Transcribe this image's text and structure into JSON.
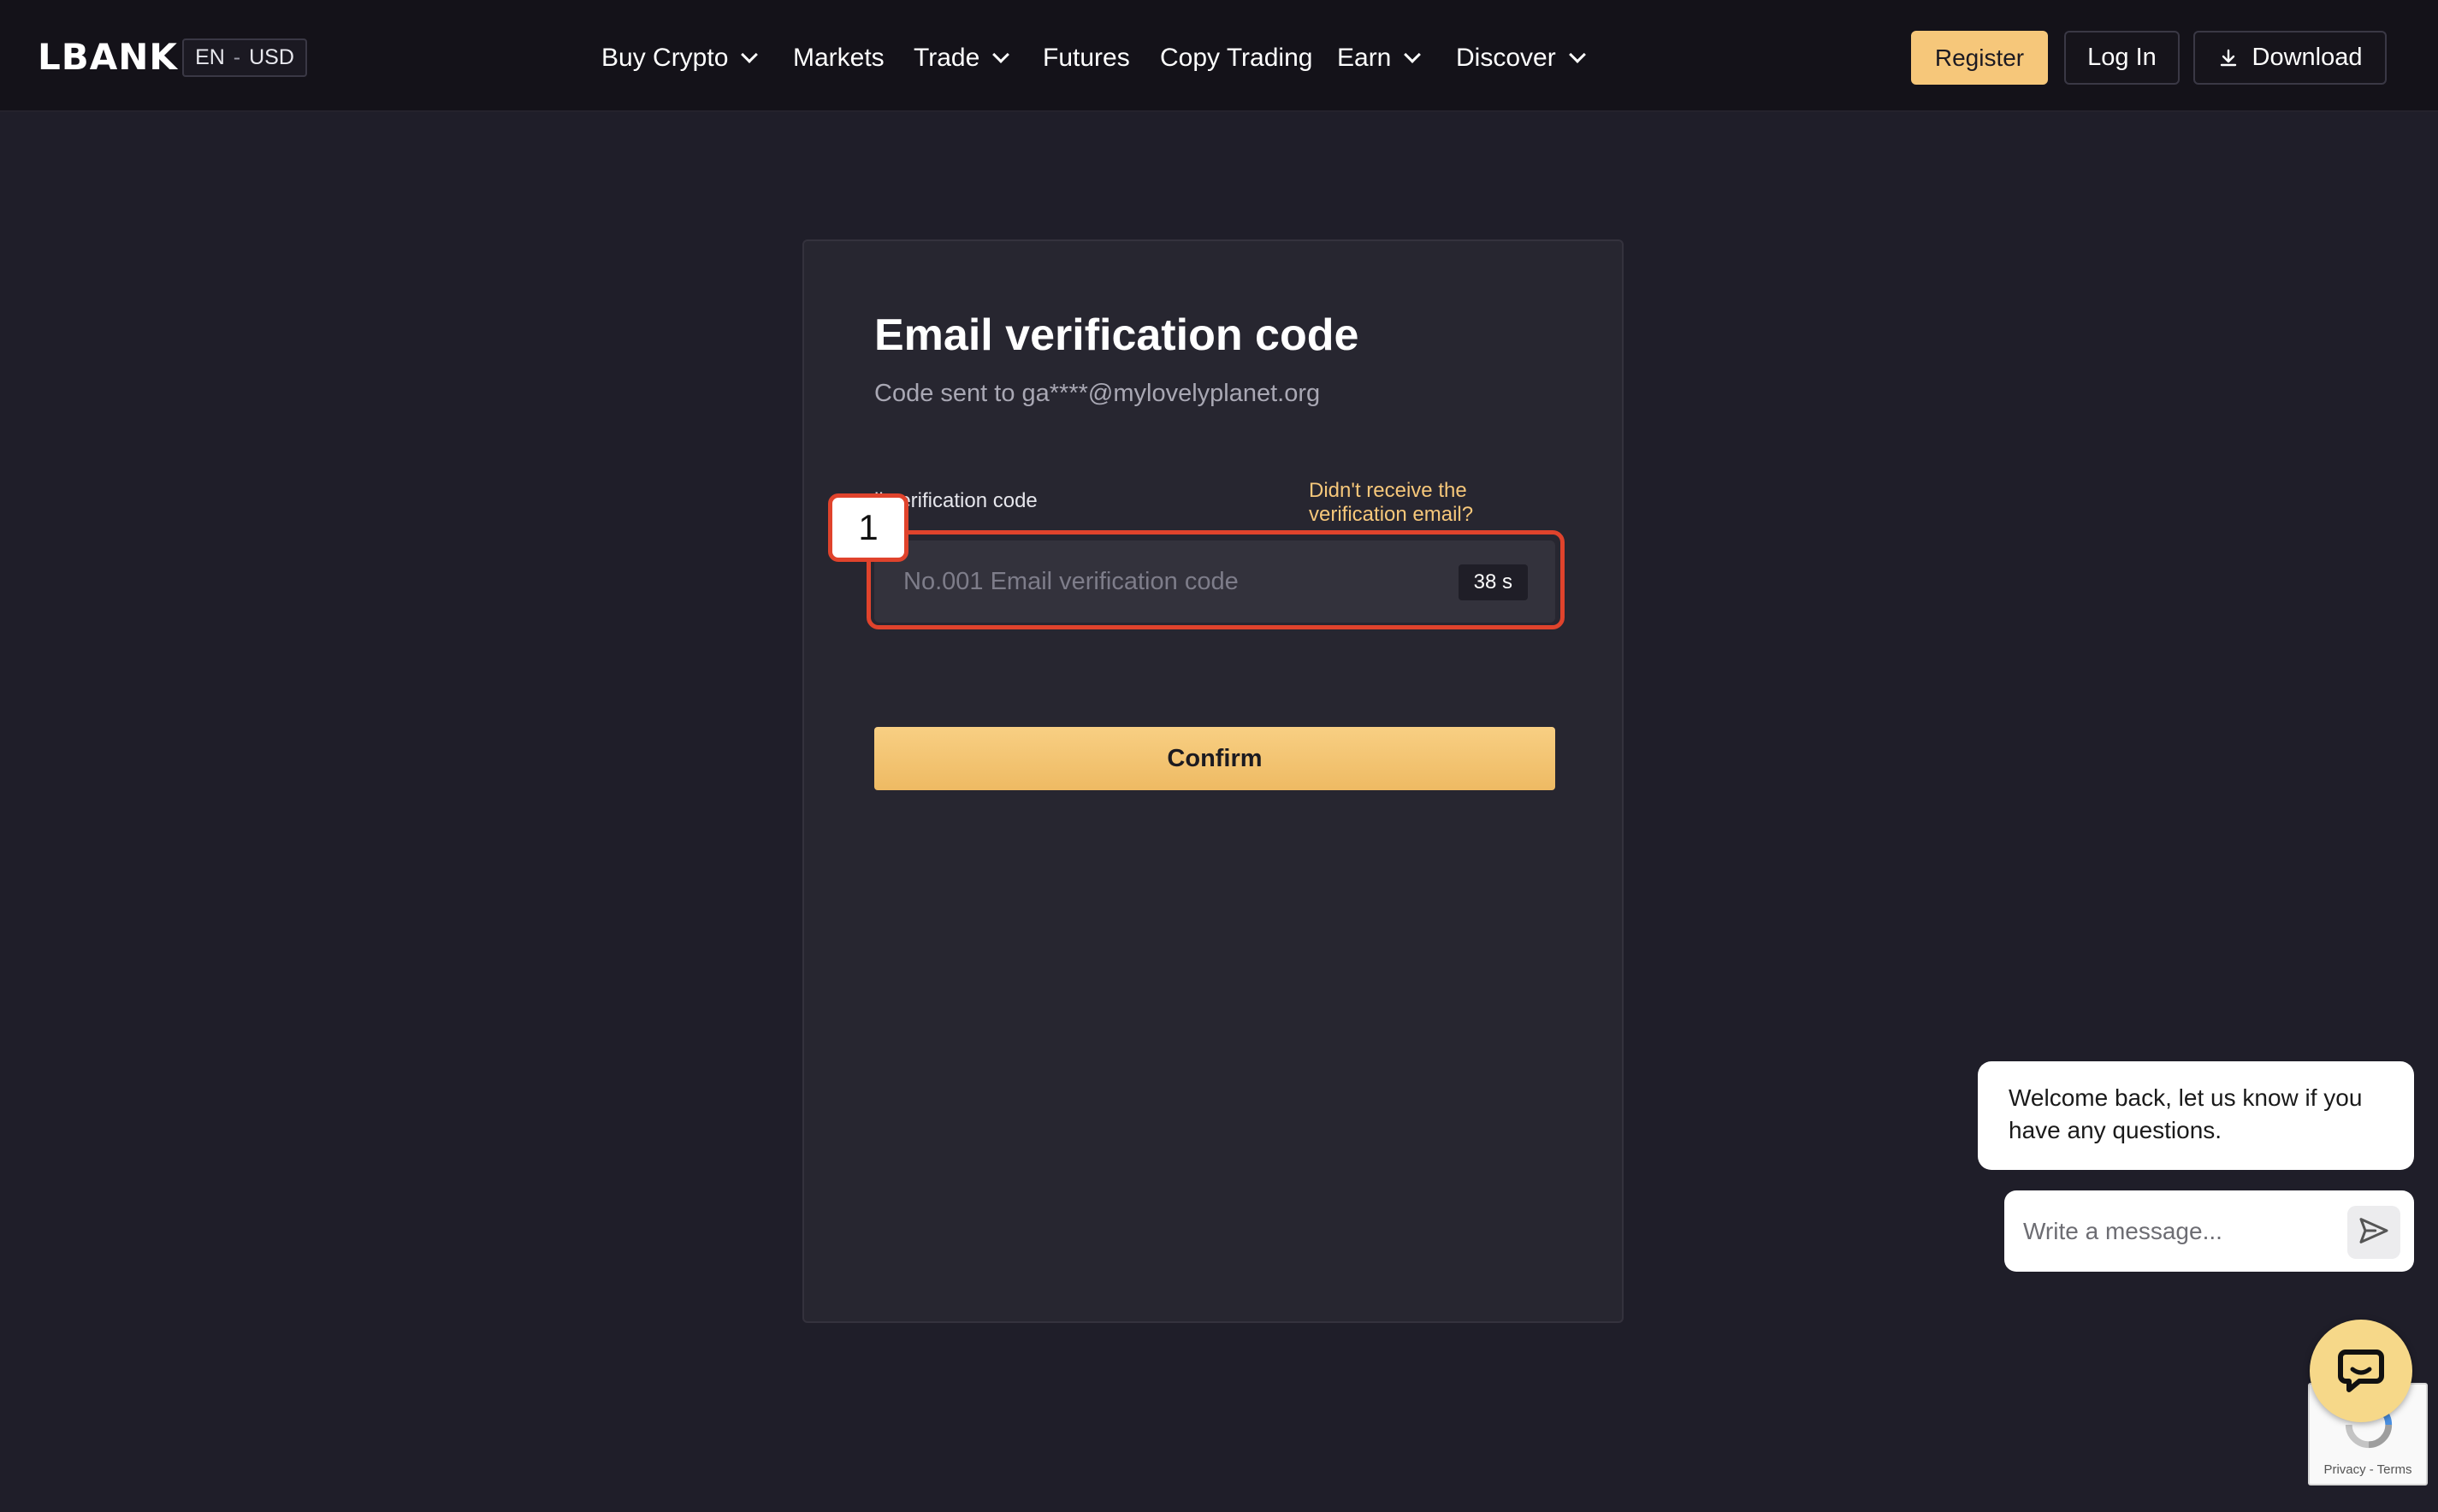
{
  "header": {
    "logo": "LBANK",
    "locale": {
      "language": "EN",
      "separator": "-",
      "currency": "USD"
    },
    "nav": [
      {
        "label": "Buy Crypto",
        "dropdown": true
      },
      {
        "label": "Markets",
        "dropdown": false
      },
      {
        "label": "Trade",
        "dropdown": true
      },
      {
        "label": "Futures",
        "dropdown": false
      },
      {
        "label": "Copy Trading",
        "dropdown": false
      },
      {
        "label": "Earn",
        "dropdown": true
      },
      {
        "label": "Discover",
        "dropdown": true
      }
    ],
    "register_label": "Register",
    "login_label": "Log In",
    "download_label": "Download"
  },
  "verification": {
    "title": "Email verification code",
    "subtitle": "Code sent to ga****@mylovelyplanet.org",
    "field_label": "il verification code",
    "resend_link": "Didn't receive the verification email?",
    "input_placeholder": "No.001 Email verification code",
    "input_value": "",
    "countdown": "38 s",
    "confirm_label": "Confirm",
    "step_marker": "1"
  },
  "chat": {
    "greeting": "Welcome back, let us know if you have any questions.",
    "input_placeholder": "Write a message...",
    "recaptcha_text": "Privacy - Terms"
  },
  "colors": {
    "page_bg": "#1f1e29",
    "header_bg": "#141219",
    "card_bg": "#272630",
    "accent": "#f6c77a",
    "highlight": "#e0432c",
    "chat_launcher": "#f6d889"
  },
  "icons": {
    "download": "download-icon",
    "nav_dropdown": "chevron-down-icon",
    "send": "send-icon",
    "chat_launcher": "chat-icon",
    "recaptcha": "recaptcha-icon"
  }
}
